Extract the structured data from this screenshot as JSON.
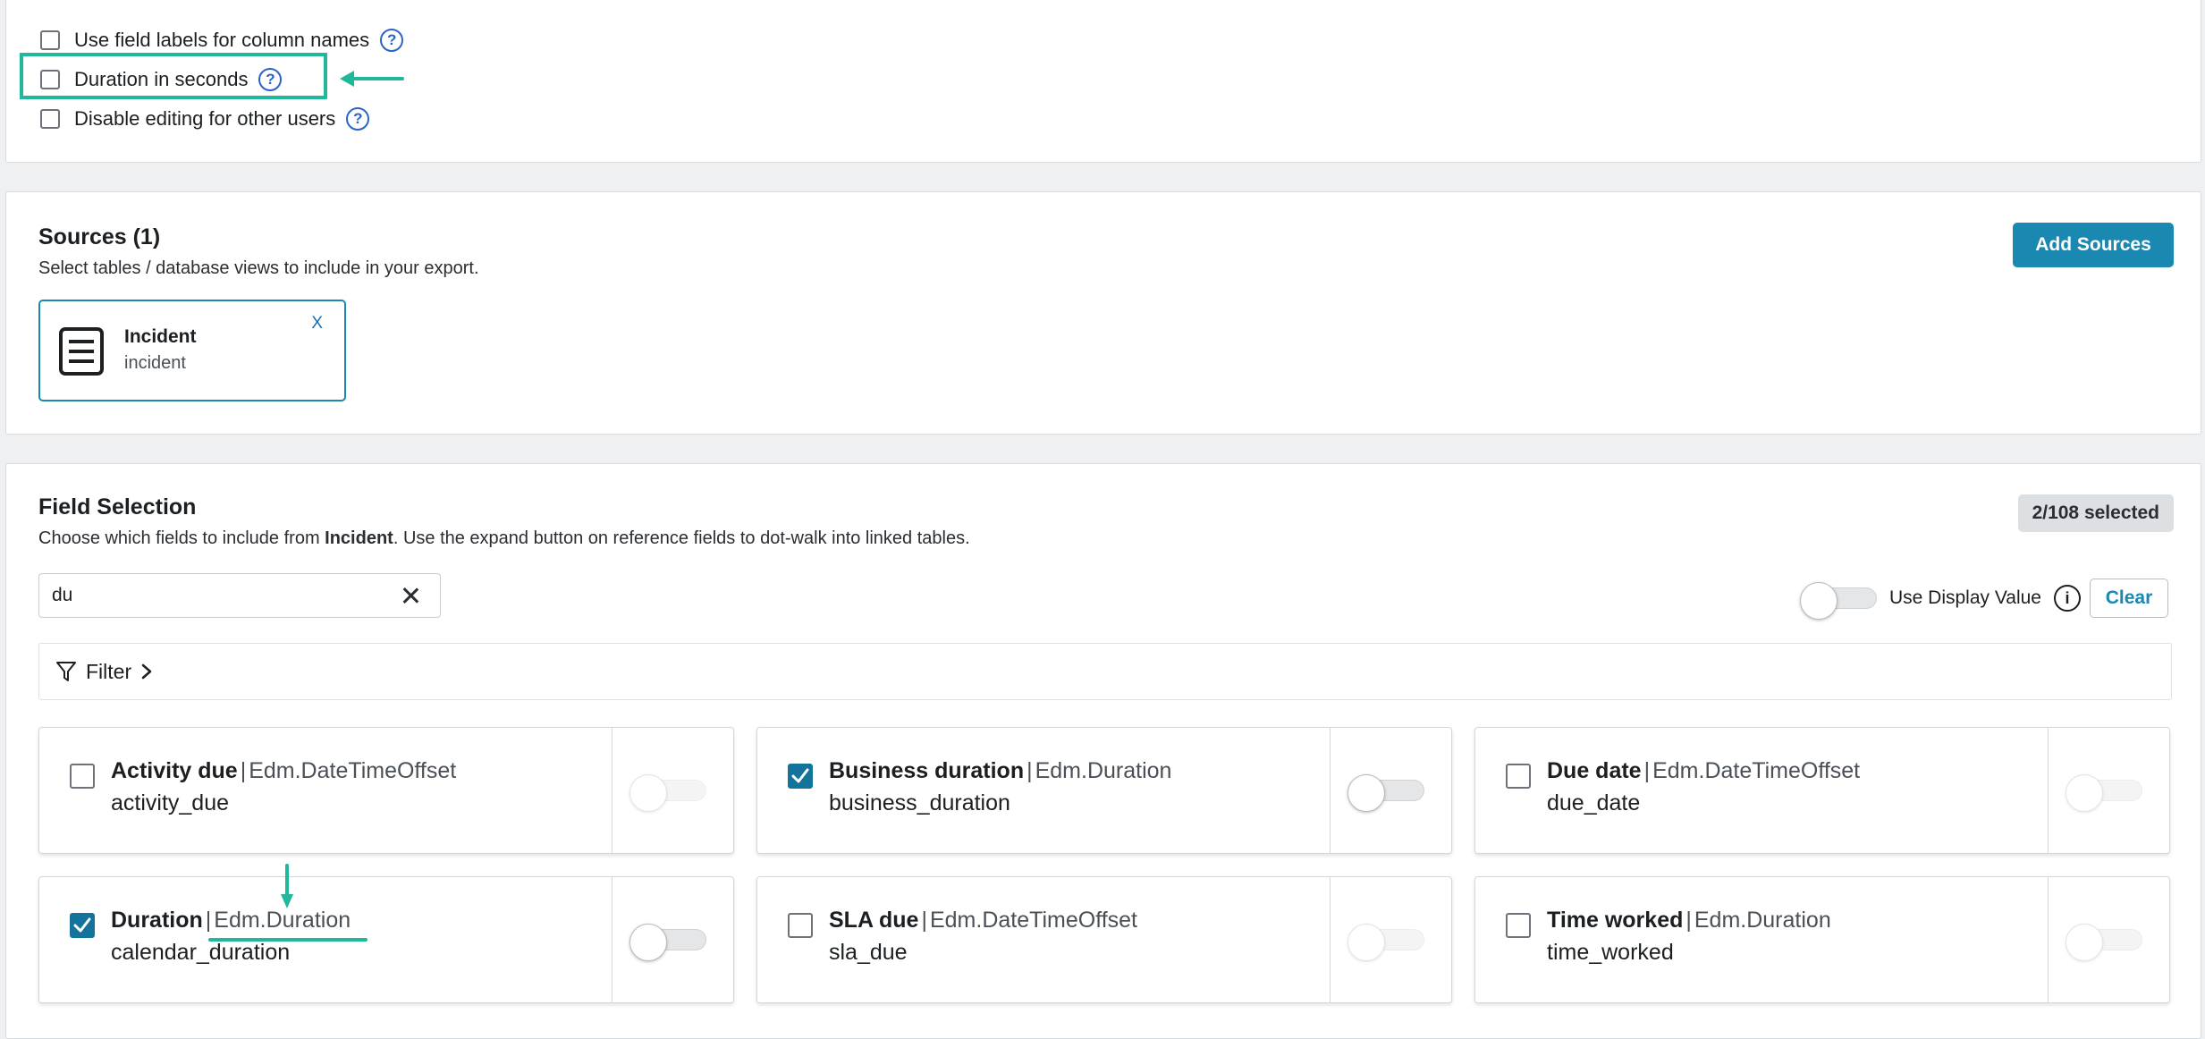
{
  "options": [
    {
      "label": "Use field labels for column names",
      "checked": false
    },
    {
      "label": "Duration in seconds",
      "checked": false,
      "highlighted": true
    },
    {
      "label": "Disable editing for other users",
      "checked": false
    }
  ],
  "help_icon_glyph": "?",
  "sources": {
    "title": "Sources (1)",
    "subtitle": "Select tables / database views to include in your export.",
    "add_button": "Add Sources",
    "items": [
      {
        "name": "Incident",
        "table": "incident",
        "remove": "X",
        "icon": "document-icon"
      }
    ]
  },
  "field_selection": {
    "title": "Field Selection",
    "subtitle_prefix": "Choose which fields to include from ",
    "subtitle_table": "Incident",
    "subtitle_suffix": ". Use the expand button on reference fields to dot-walk into linked tables.",
    "selected_badge": "2/108 selected",
    "search": {
      "value": "du"
    },
    "display_value_label": "Use Display Value",
    "info_glyph": "i",
    "clear_button": "Clear",
    "filter_label": "Filter",
    "fields": [
      {
        "label": "Activity due",
        "sep": "|",
        "type": "Edm.DateTimeOffset",
        "name": "activity_due",
        "checked": false,
        "toggle_enabled": false
      },
      {
        "label": "Business duration",
        "sep": "|",
        "type": "Edm.Duration",
        "name": "business_duration",
        "checked": true,
        "toggle_enabled": true
      },
      {
        "label": "Due date",
        "sep": "|",
        "type": "Edm.DateTimeOffset",
        "name": "due_date",
        "checked": false,
        "toggle_enabled": false
      },
      {
        "label": "Duration",
        "sep": "|",
        "type": "Edm.Duration",
        "name": "calendar_duration",
        "checked": true,
        "toggle_enabled": true
      },
      {
        "label": "SLA due",
        "sep": "|",
        "type": "Edm.DateTimeOffset",
        "name": "sla_due",
        "checked": false,
        "toggle_enabled": false
      },
      {
        "label": "Time worked",
        "sep": "|",
        "type": "Edm.Duration",
        "name": "time_worked",
        "checked": false,
        "toggle_enabled": false
      }
    ]
  },
  "colors": {
    "accent": "#1a88b0",
    "checkbox_checked": "#14739a",
    "annotation": "#1fb89a",
    "help_icon": "#2a63c9"
  }
}
